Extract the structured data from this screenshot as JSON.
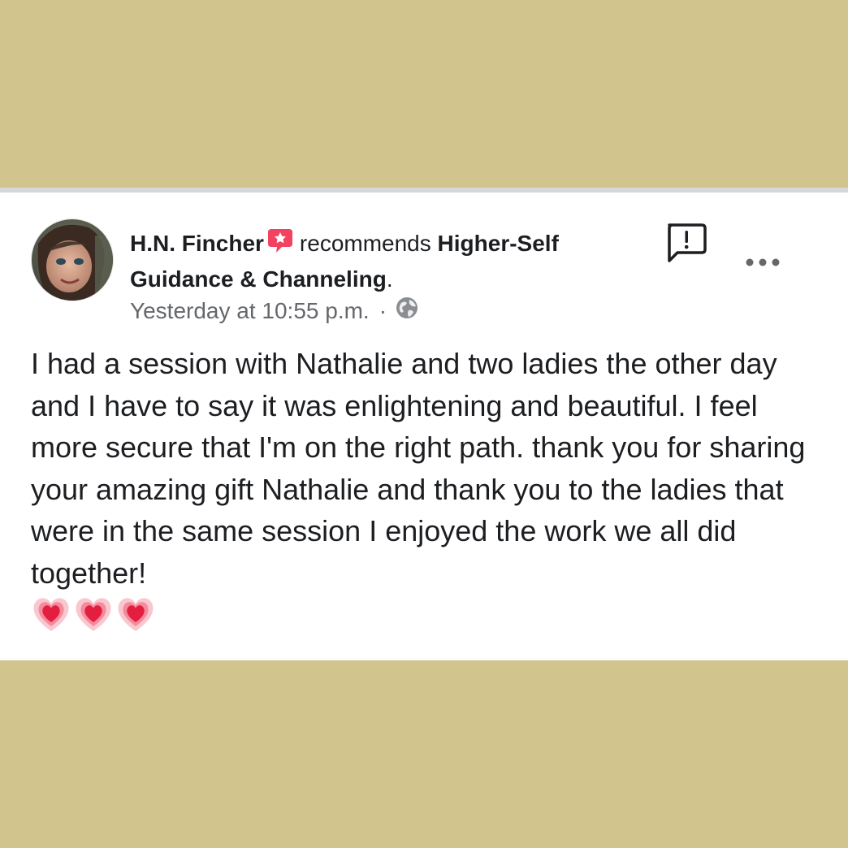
{
  "post": {
    "author": "H.N. Fincher",
    "verb": "recommends",
    "page_name": "Higher-Self Guidance & Channeling",
    "page_suffix": ".",
    "timestamp": "Yesterday at 10:55 p.m.",
    "separator": "·",
    "privacy_icon": "globe-icon",
    "recommend_icon": "recommend-star-icon",
    "body": "I had a session with Nathalie and two ladies the other day and I have to say it was enlightening and beautiful. I feel more secure that I'm on the right path. thank you for sharing your amazing gift Nathalie and thank you to the ladies that were in the same session I enjoyed the work we all did together!",
    "emojis": [
      "heart",
      "heart",
      "heart"
    ]
  },
  "actions": {
    "report_icon": "report-bubble-icon",
    "more_icon": "more-options-icon"
  },
  "colors": {
    "background": "#d1c48d",
    "card": "#ffffff",
    "text": "#1c1e21",
    "secondary_text": "#65676b",
    "recommend_badge": "#f3425f",
    "heart": "#e41e3f"
  }
}
